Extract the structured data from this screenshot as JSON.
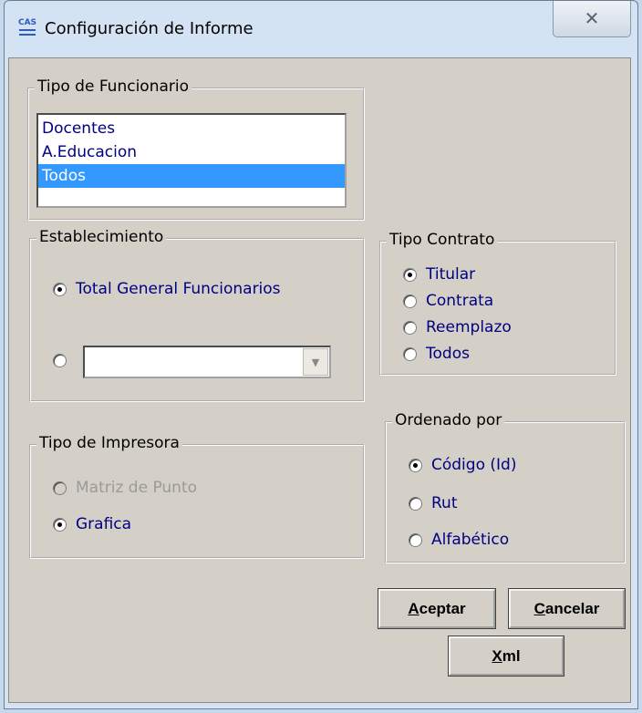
{
  "window": {
    "title": "Configuración de Informe",
    "icon_text": "CAS",
    "close_glyph": "✕"
  },
  "tipo_funcionario": {
    "legend": "Tipo de Funcionario",
    "items": [
      "Docentes",
      "A.Educacion",
      "Todos"
    ],
    "selected": "Todos"
  },
  "establecimiento": {
    "legend": "Establecimiento",
    "option_total": "Total General Funcionarios",
    "option_total_checked": true,
    "combo_value": ""
  },
  "tipo_contrato": {
    "legend": "Tipo Contrato",
    "options": [
      "Titular",
      "Contrata",
      "Reemplazo",
      "Todos"
    ],
    "selected": "Titular"
  },
  "tipo_impresora": {
    "legend": "Tipo de Impresora",
    "options": [
      "Matriz de Punto",
      "Grafica"
    ],
    "selected": "Grafica",
    "disabled": [
      "Matriz de Punto"
    ]
  },
  "ordenado_por": {
    "legend": "Ordenado por",
    "options": [
      "Código (Id)",
      "Rut",
      "Alfabético"
    ],
    "selected": "Código (Id)"
  },
  "buttons": {
    "aceptar": {
      "accel": "A",
      "rest": "ceptar"
    },
    "cancelar": {
      "accel": "C",
      "rest": "ancelar"
    },
    "xml": {
      "accel": "X",
      "rest": "ml"
    }
  },
  "colors": {
    "option_text": "#000080",
    "selection": "#3399ff",
    "dialog_face": "#d4d0c8"
  }
}
